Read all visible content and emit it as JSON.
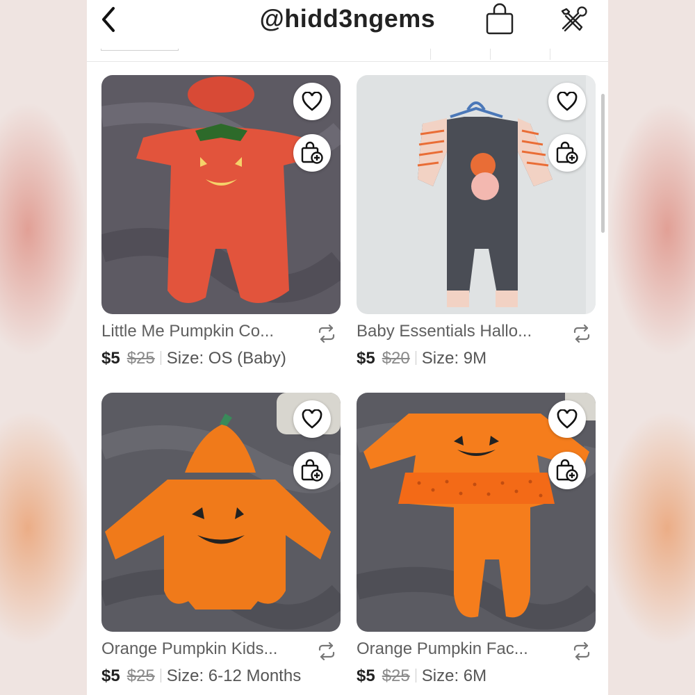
{
  "header": {
    "title": "@hidd3ngems",
    "icons": [
      "chevron-left-icon",
      "shopping-bag-icon",
      "tools-icon"
    ]
  },
  "listings": [
    {
      "name": "Little Me Pumpkin Co...",
      "price": "$5",
      "original_price": "$25",
      "size_label": "Size:",
      "size": "OS (Baby)"
    },
    {
      "name": "Baby Essentials Hallo...",
      "price": "$5",
      "original_price": "$20",
      "size_label": "Size:",
      "size": "9M"
    },
    {
      "name": "Orange Pumpkin Kids...",
      "price": "$5",
      "original_price": "$25",
      "size_label": "Size:",
      "size": "6-12 Months"
    },
    {
      "name": "Orange Pumpkin Fac...",
      "price": "$5",
      "original_price": "$25",
      "size_label": "Size:",
      "size": "6M"
    }
  ],
  "colors": {
    "text_primary": "#222222",
    "text_secondary": "#5f5f5f",
    "pumpkin_orange": "#f07a1a",
    "velour_red": "#e2543c",
    "blanket_gray": "#5b5b62"
  }
}
